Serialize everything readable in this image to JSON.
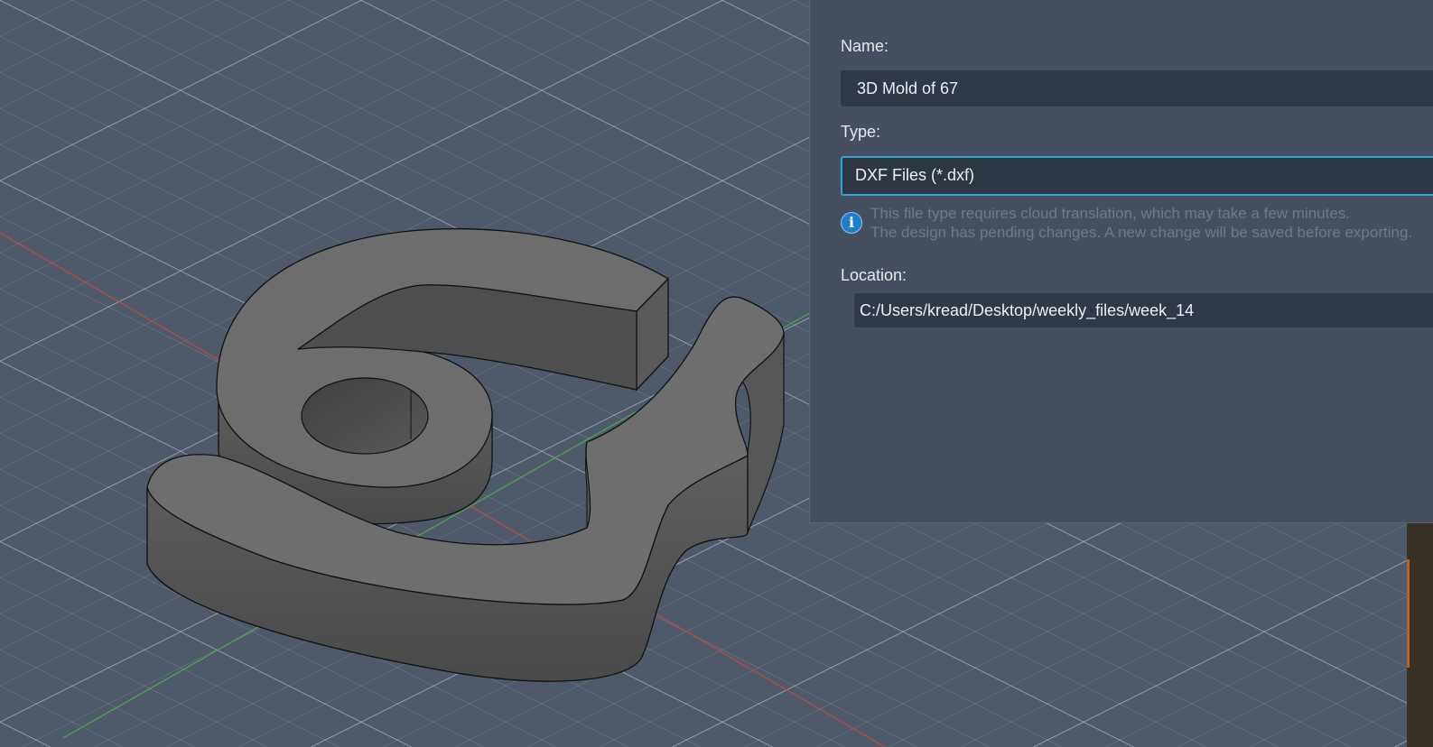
{
  "export_dialog": {
    "name_label": "Name:",
    "name_value": "3D Mold of 67",
    "type_label": "Type:",
    "type_value": "DXF Files (*.dxf)",
    "info_line1": "This file type requires cloud translation, which may take a few minutes.",
    "info_line2": "The design has pending changes. A new change will be saved before exporting.",
    "location_label": "Location:",
    "location_value": "C:/Users/kread/Desktop/weekly_files/week_14"
  },
  "viewport": {
    "grid_color": "#aeb6c4",
    "background_color": "#4e596a",
    "model_color": "#6d6d6d",
    "x_axis_color": "#c04848",
    "y_axis_color": "#4fa84f",
    "model_icon": "3d-digit-67-model"
  },
  "colors": {
    "dialog_bg": "#464f5f",
    "input_bg": "#2f3846",
    "focus_border": "#2fa3dc",
    "info_icon": "#1f7ec4"
  }
}
